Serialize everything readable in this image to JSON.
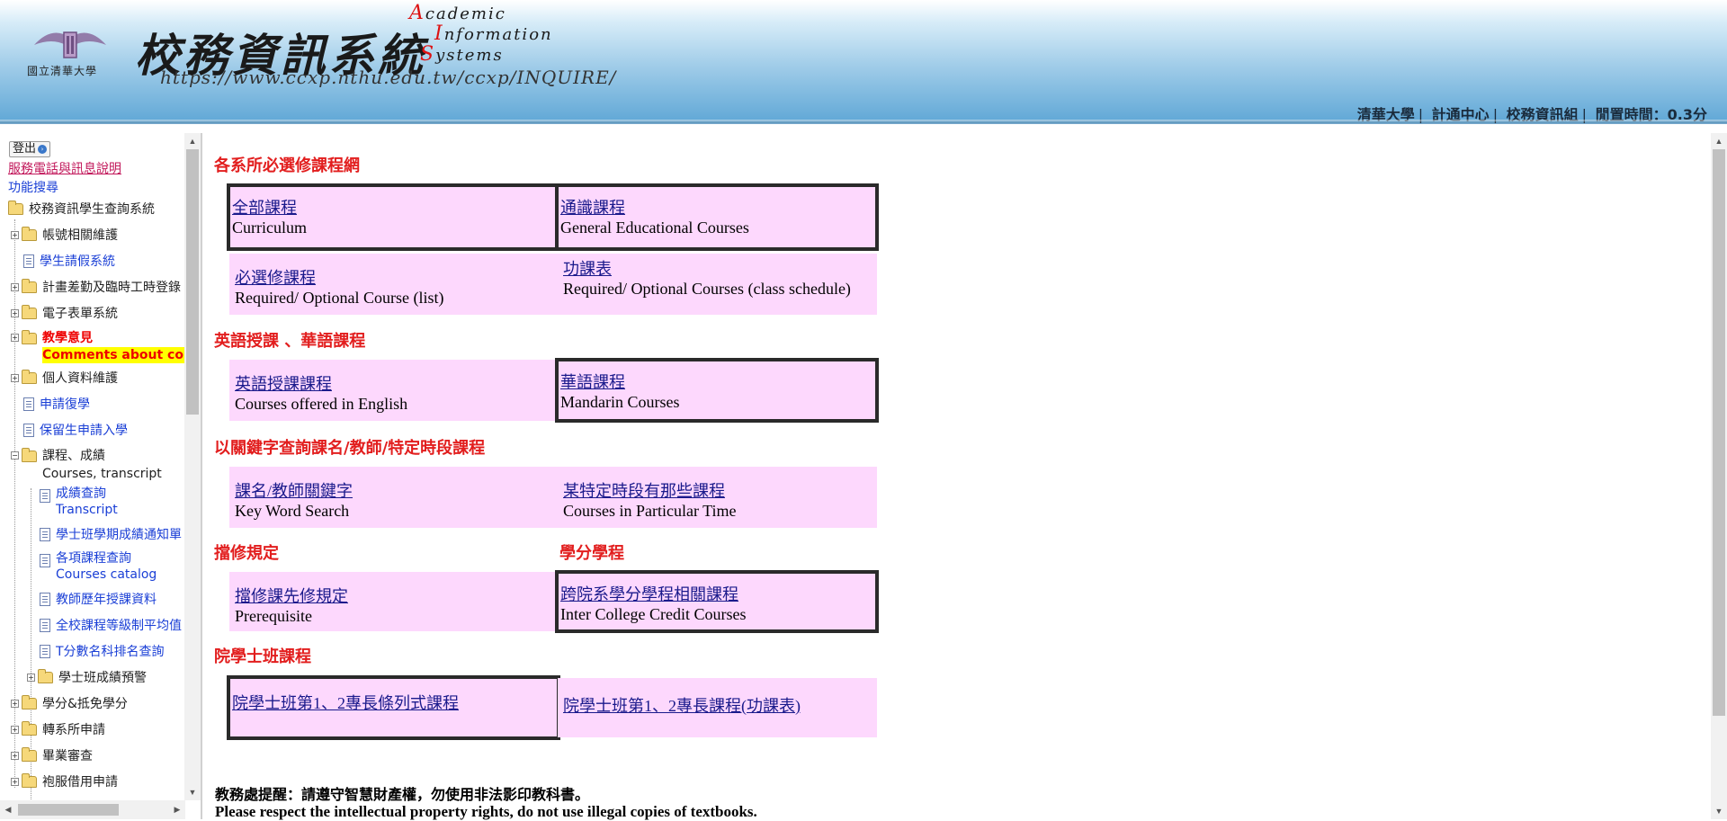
{
  "header": {
    "logo_caption": "國立清華大學",
    "title_cn": "校務資訊系統",
    "title_en": [
      {
        "cap": "A",
        "rest": "cademic"
      },
      {
        "cap": "I",
        "rest": "nformation"
      },
      {
        "cap": "S",
        "rest": "ystems"
      }
    ],
    "url": "https://www.ccxp.nthu.edu.tw/ccxp/INQUIRE/",
    "links": [
      "清華大學",
      "計通中心",
      "校務資訊組"
    ],
    "separator": "|",
    "idle_time": "閒置時間：0.3分"
  },
  "sidebar": {
    "logout": "登出",
    "service_link": "服務電話與訊息說明",
    "function_search": "功能搜尋",
    "root": "校務資訊學生查詢系統",
    "items": [
      {
        "label": "帳號相關維護",
        "type": "folder"
      },
      {
        "label": "學生請假系統",
        "type": "doc"
      },
      {
        "label": "計畫差勤及臨時工時登錄",
        "type": "folder"
      },
      {
        "label": "電子表單系統",
        "type": "folder"
      },
      {
        "label": "教學意見",
        "sub": "Comments about courses",
        "type": "folder-highlight"
      },
      {
        "label": "個人資料維護",
        "type": "folder"
      },
      {
        "label": "申請復學",
        "type": "doc"
      },
      {
        "label": "保留生申請入學",
        "type": "doc"
      },
      {
        "label": "課程、成績",
        "sub": "Courses, transcript",
        "type": "folder-open"
      }
    ],
    "sub_items": [
      {
        "label": "成績查詢",
        "sub": "Transcript"
      },
      {
        "label": "學士班學期成績通知單"
      },
      {
        "label": "各項課程查詢",
        "sub": "Courses catalog"
      },
      {
        "label": "教師歷年授課資料"
      },
      {
        "label": "全校課程等級制平均值"
      },
      {
        "label": "T分數名科排名查詢"
      }
    ],
    "sub_folder": "學士班成績預警",
    "bottom_items": [
      "學分&抵免學分",
      "轉系所申請",
      "畢業審查",
      "袍服借用申請"
    ]
  },
  "main": {
    "sections": {
      "required": "各系所必選修課程網",
      "english": "英語授課 、華語課程",
      "keyword": "以關鍵字查詢課名/教師/特定時段課程",
      "prereq": "擋修規定",
      "credit": "學分學程",
      "college": "院學士班課程"
    },
    "cells": {
      "all_cn": "全部課程",
      "all_en": "Curriculum",
      "general_cn": "通識課程",
      "general_en": "General Educational Courses",
      "req_list_cn": "必選修課程",
      "req_list_en": "Required/ Optional Course (list)",
      "schedule_cn": "功課表",
      "schedule_en": "Required/ Optional Courses (class schedule)",
      "eng_cn": "英語授課課程",
      "eng_en": "Courses offered in English",
      "mandarin_cn": "華語課程",
      "mandarin_en": "Mandarin Courses",
      "keyword_cn": "課名/教師關鍵字",
      "keyword_en": "Key Word Search",
      "time_cn": "某特定時段有那些課程",
      "time_en": "Courses in Particular Time",
      "prereq_cn": "擋修課先修規定",
      "prereq_en": "Prerequisite",
      "inter_cn": "跨院系學分學程相關課程",
      "inter_en": "Inter College Credit Courses",
      "college_list": "院學士班第1、2專長條列式課程",
      "college_schedule": "院學士班第1、2專長課程(功課表)"
    },
    "notice_cn": "教務處提醒：請遵守智慧財產權，勿使用非法影印教科書。",
    "notice_en": "Please respect the intellectual property rights, do not use illegal copies of textbooks."
  },
  "colors": {
    "section_red": "#e21e1e",
    "cell_pink": "#fdd8fd",
    "link_blue": "#1a3fd6",
    "header_blue": "#5fa7d6"
  }
}
